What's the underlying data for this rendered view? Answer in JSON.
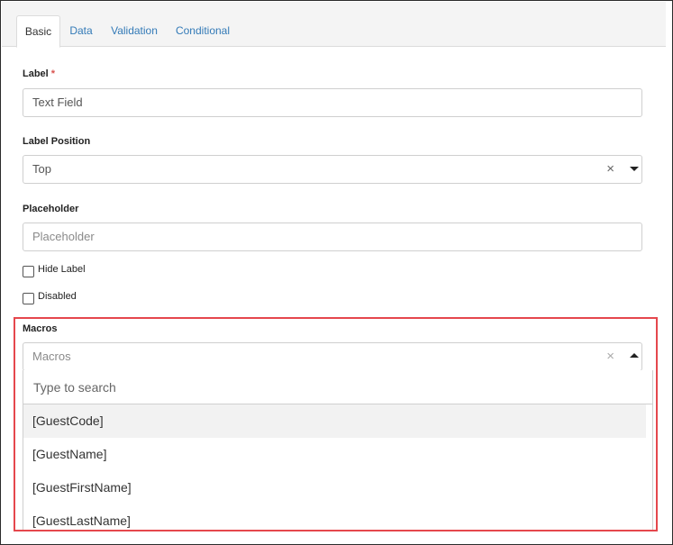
{
  "tabs": [
    {
      "label": "Basic"
    },
    {
      "label": "Data"
    },
    {
      "label": "Validation"
    },
    {
      "label": "Conditional"
    }
  ],
  "fields": {
    "label": {
      "label": "Label",
      "required_mark": "*",
      "value": "Text Field"
    },
    "label_position": {
      "label": "Label Position",
      "value": "Top"
    },
    "placeholder": {
      "label": "Placeholder",
      "placeholder": "Placeholder"
    },
    "hide_label": {
      "label": "Hide Label",
      "checked": false
    },
    "disabled": {
      "label": "Disabled",
      "checked": false
    },
    "macros": {
      "label": "Macros",
      "placeholder": "Macros",
      "search_placeholder": "Type to search",
      "options": [
        "[GuestCode]",
        "[GuestName]",
        "[GuestFirstName]",
        "[GuestLastName]"
      ],
      "expanded": true
    }
  },
  "icons": {
    "clear": "close-icon",
    "dropdown_closed": "caret-down-icon",
    "dropdown_open": "caret-up-icon"
  },
  "colors": {
    "tab_link": "#337ab7",
    "highlight_border": "#e5474d",
    "required": "#d9534f"
  },
  "glyphs": {
    "clear": "×"
  }
}
